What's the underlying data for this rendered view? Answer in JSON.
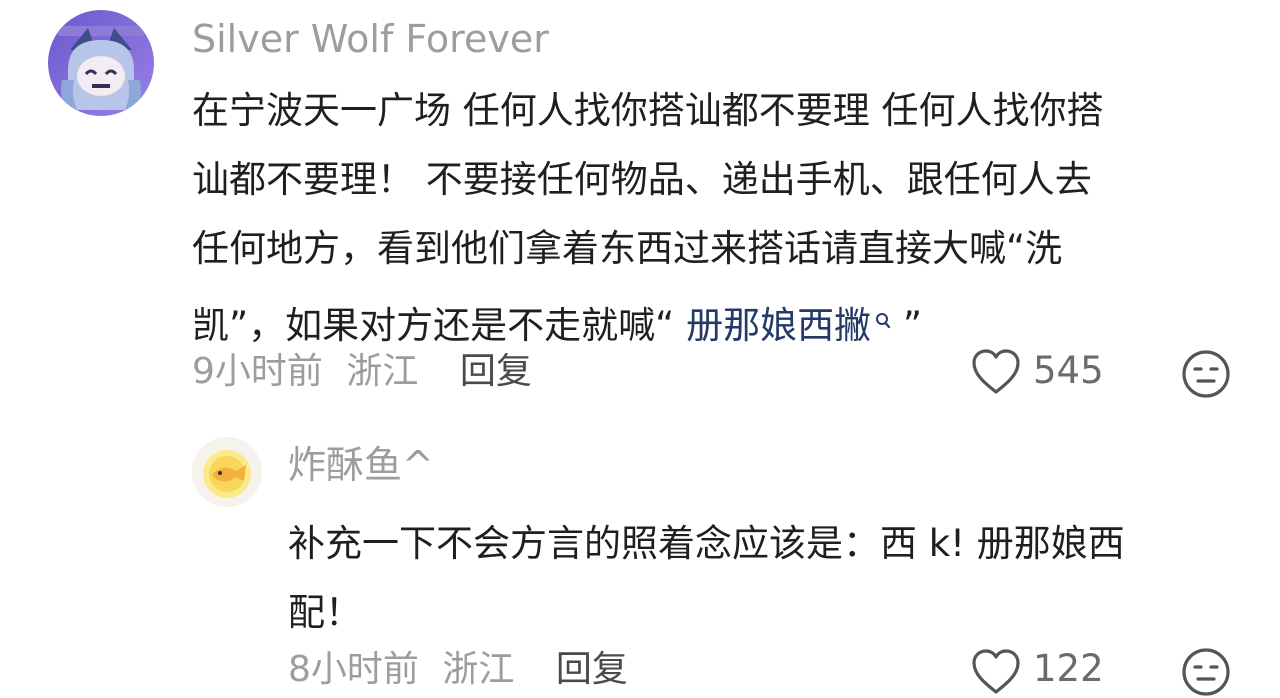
{
  "comments": [
    {
      "username": "Silver Wolf Forever",
      "text_lines": [
        "在宁波天一广场 任何人找你搭讪都不要理 任何人找你搭",
        "讪都不要理！ 不要接任何物品、递出手机、跟任何人去",
        "任何地方，看到他们拿着东西过来搭话请直接大喊“洗"
      ],
      "last_line_prefix": "凯”，如果对方还是不走就喊“ ",
      "search_link_text": "册那娘西撇",
      "last_line_suffix": " ”",
      "time": "9小时前",
      "location": "浙江",
      "reply_label": "回复",
      "likes": "545"
    },
    {
      "username": "炸酥鱼^",
      "text_lines": [
        "补充一下不会方言的照着念应该是：西 k! 册那娘西",
        "配！"
      ],
      "time": "8小时前",
      "location": "浙江",
      "reply_label": "回复",
      "likes": "122"
    }
  ],
  "icons": {
    "like": "heart-outline-icon",
    "dislike": "meh-face-icon",
    "search": "magnifier-icon"
  }
}
